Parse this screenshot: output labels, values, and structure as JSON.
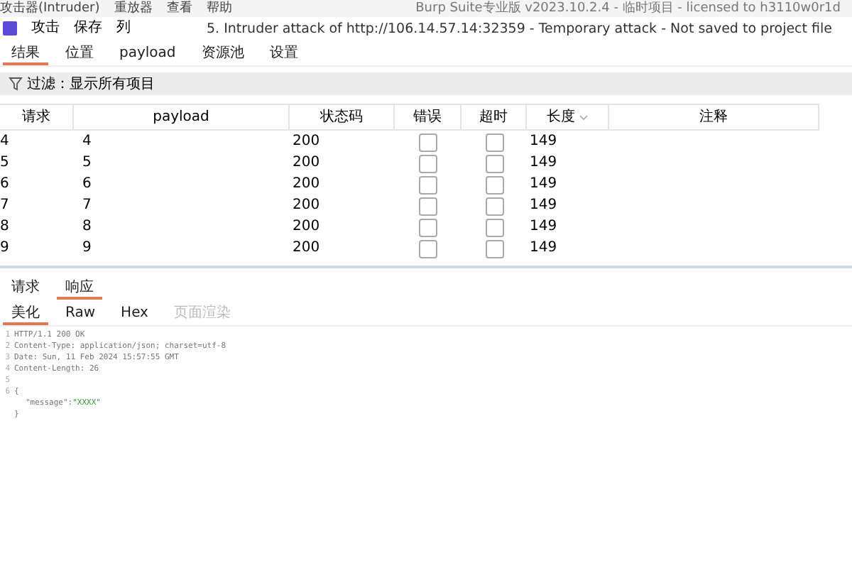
{
  "app_bar": {
    "menu": [
      "攻击器(Intruder)",
      "重放器",
      "查看",
      "帮助"
    ],
    "title": "Burp Suite专业版  v2023.10.2.4 - 临时项目 - licensed to h3110w0r1d"
  },
  "attack_bar": {
    "menu": [
      "攻击",
      "保存",
      "列"
    ],
    "title": "5. Intruder attack of http://106.14.57.14:32359 - Temporary attack - Not saved to project file"
  },
  "tabs": [
    {
      "label": "结果",
      "selected": true
    },
    {
      "label": "位置",
      "selected": false
    },
    {
      "label": "payload",
      "selected": false
    },
    {
      "label": "资源池",
      "selected": false
    },
    {
      "label": "设置",
      "selected": false
    }
  ],
  "filter": {
    "label": "过滤：显示所有项目"
  },
  "table": {
    "columns": [
      "请求",
      "payload",
      "状态码",
      "错误",
      "超时",
      "长度",
      "注释"
    ],
    "rows": [
      {
        "request": "4",
        "payload": "4",
        "status": "200",
        "error": false,
        "timeout": false,
        "length": "149"
      },
      {
        "request": "5",
        "payload": "5",
        "status": "200",
        "error": false,
        "timeout": false,
        "length": "149"
      },
      {
        "request": "6",
        "payload": "6",
        "status": "200",
        "error": false,
        "timeout": false,
        "length": "149"
      },
      {
        "request": "7",
        "payload": "7",
        "status": "200",
        "error": false,
        "timeout": false,
        "length": "149"
      },
      {
        "request": "8",
        "payload": "8",
        "status": "200",
        "error": false,
        "timeout": false,
        "length": "149"
      },
      {
        "request": "9",
        "payload": "9",
        "status": "200",
        "error": false,
        "timeout": false,
        "length": "149"
      }
    ]
  },
  "message_tabs": [
    {
      "label": "请求",
      "selected": false
    },
    {
      "label": "响应",
      "selected": true
    }
  ],
  "view_tabs": [
    {
      "label": "美化",
      "selected": true,
      "disabled": false
    },
    {
      "label": "Raw",
      "selected": false,
      "disabled": false
    },
    {
      "label": "Hex",
      "selected": false,
      "disabled": false
    },
    {
      "label": "页面渲染",
      "selected": false,
      "disabled": true
    }
  ],
  "code": [
    {
      "number": "1",
      "kind": "plain",
      "text": "HTTP/1.1 200 OK"
    },
    {
      "number": "2",
      "kind": "plain",
      "text": "Content-Type: application/json; charset=utf-8"
    },
    {
      "number": "3",
      "kind": "plain",
      "text": "Date: Sun, 11 Feb 2024 15:57:55 GMT"
    },
    {
      "number": "4",
      "kind": "plain",
      "text": "Content-Length: 26"
    },
    {
      "number": "5",
      "kind": "plain"
    },
    {
      "number": "6",
      "kind": "plain",
      "text": "{"
    },
    {
      "kind": "pair",
      "key": "\"message\":",
      "value": "\"XXXX\""
    },
    {
      "kind": "plain",
      "text": "}"
    }
  ]
}
